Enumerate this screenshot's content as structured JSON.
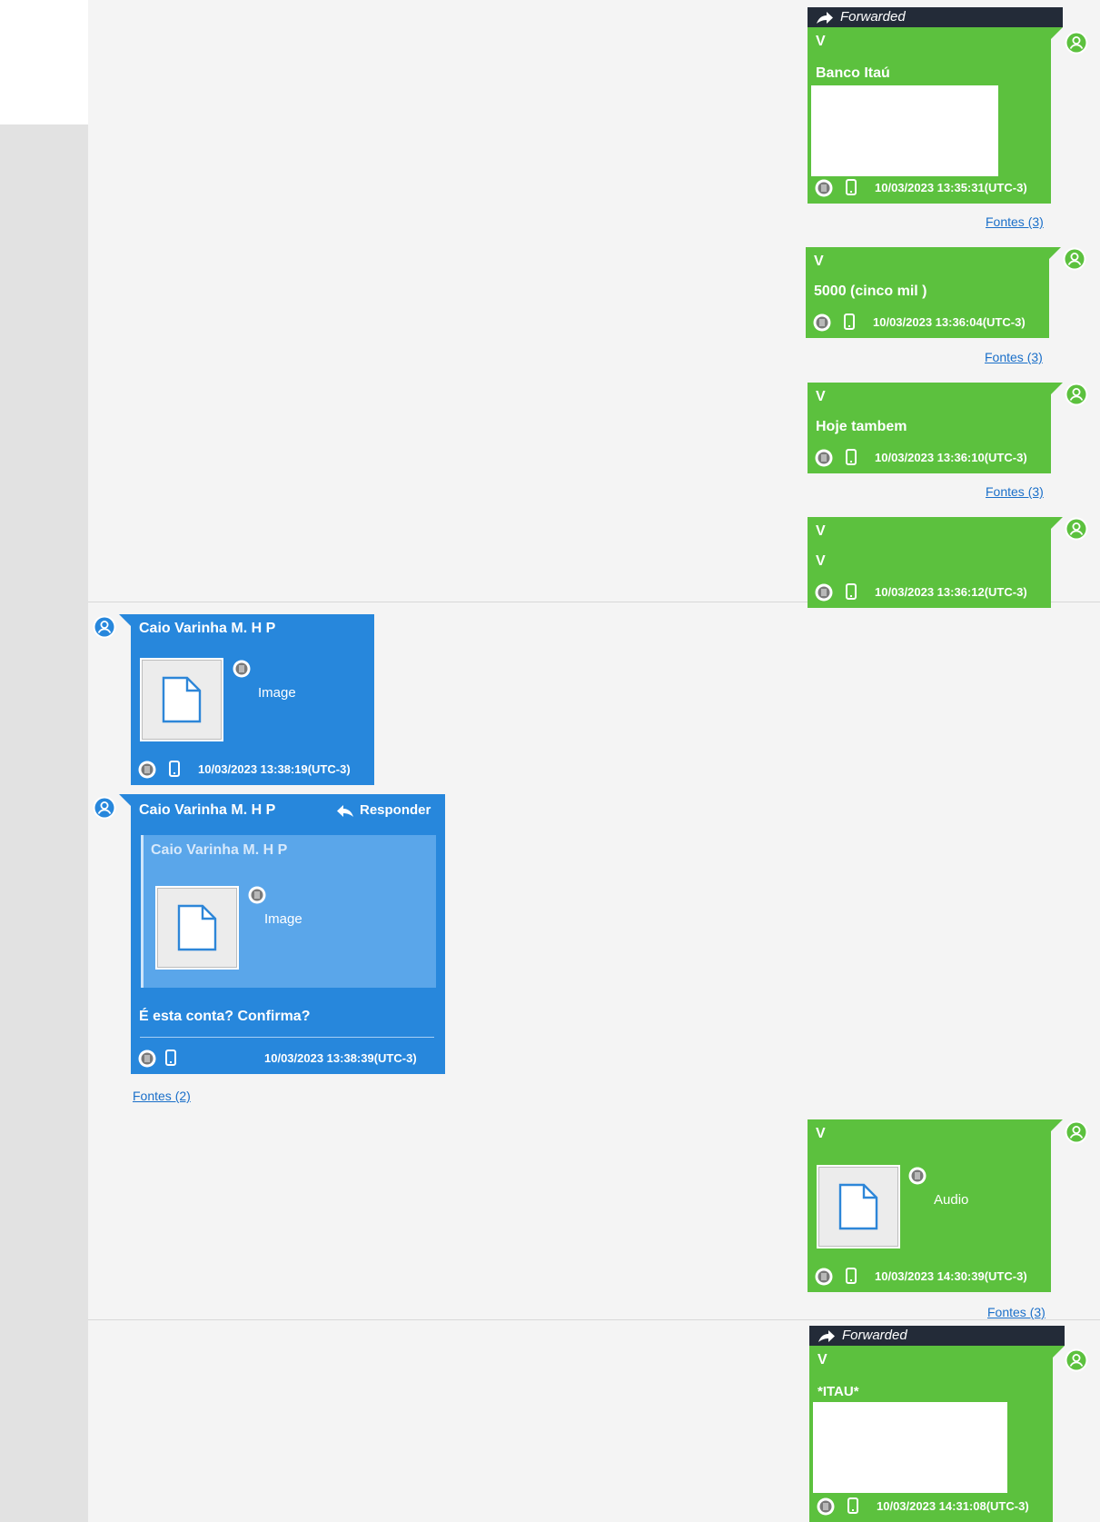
{
  "colors": {
    "outgoing": "#5cc13e",
    "incoming": "#2787dc",
    "forwarded_bar": "#232b38",
    "link": "#1a6fc9"
  },
  "icons": {
    "forwarded": "forward-arrow-icon",
    "avatar": "user-avatar-icon",
    "status": "status-dot-icon",
    "device": "phone-icon",
    "attachment": "file-icon",
    "reply": "reply-arrow-icon"
  },
  "messages": [
    {
      "forwarded": "Forwarded",
      "sender": "V",
      "text": "Banco Itaú",
      "timestamp": "10/03/2023 13:35:31(UTC-3)",
      "sources": "Fontes (3)"
    },
    {
      "sender": "V",
      "text": "5000 (cinco mil )",
      "timestamp": "10/03/2023 13:36:04(UTC-3)",
      "sources": "Fontes (3)"
    },
    {
      "sender": "V",
      "text": "Hoje tambem",
      "timestamp": "10/03/2023 13:36:10(UTC-3)",
      "sources": "Fontes (3)"
    },
    {
      "sender": "V",
      "text": "V",
      "timestamp": "10/03/2023 13:36:12(UTC-3)"
    },
    {
      "sender": "Caio Varinha M. H P",
      "attachment": "Image",
      "timestamp": "10/03/2023 13:38:19(UTC-3)"
    },
    {
      "sender": "Caio Varinha M. H P",
      "reply_label": "Responder",
      "quoted_sender": "Caio Varinha M. H P",
      "quoted_attachment": "Image",
      "text": "É esta conta? Confirma?",
      "timestamp": "10/03/2023 13:38:39(UTC-3)",
      "sources": "Fontes (2)"
    },
    {
      "sender": "V",
      "attachment": "Audio",
      "timestamp": "10/03/2023 14:30:39(UTC-3)",
      "sources": "Fontes (3)"
    },
    {
      "forwarded": "Forwarded",
      "sender": "V",
      "text": "*ITAU*",
      "timestamp": "10/03/2023 14:31:08(UTC-3)"
    }
  ]
}
